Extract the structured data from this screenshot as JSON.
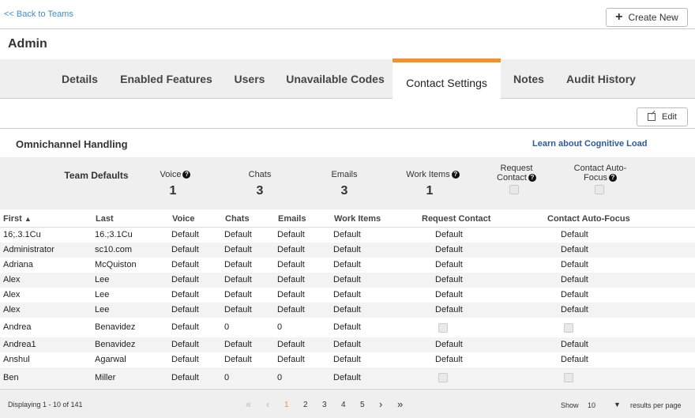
{
  "header": {
    "back_link": "<< Back to Teams",
    "create_button": "Create New",
    "page_title": "Admin"
  },
  "tabs": [
    {
      "label": "Details"
    },
    {
      "label": "Enabled Features"
    },
    {
      "label": "Users"
    },
    {
      "label": "Unavailable Codes"
    },
    {
      "label": "Contact Settings",
      "active": true
    },
    {
      "label": "Notes"
    },
    {
      "label": "Audit History"
    }
  ],
  "toolbar": {
    "edit_button": "Edit"
  },
  "section": {
    "title": "Omnichannel Handling",
    "learn_link": "Learn about Cognitive Load"
  },
  "team_defaults": {
    "label": "Team Defaults",
    "voice_label": "Voice",
    "voice_value": "1",
    "chats_label": "Chats",
    "chats_value": "3",
    "emails_label": "Emails",
    "emails_value": "3",
    "work_items_label": "Work Items",
    "work_items_value": "1",
    "request_contact_label_1": "Request",
    "request_contact_label_2": "Contact",
    "auto_focus_label_1": "Contact Auto-",
    "auto_focus_label_2": "Focus"
  },
  "table": {
    "columns": [
      "First",
      "Last",
      "Voice",
      "Chats",
      "Emails",
      "Work Items",
      "Request Contact",
      "Contact Auto-Focus"
    ],
    "sort_indicator": "▲",
    "rows": [
      {
        "first": "16;.3.1Cu",
        "last": "16.;3.1Cu",
        "voice": "Default",
        "chats": "Default",
        "emails": "Default",
        "work": "Default",
        "request": "Default",
        "focus": "Default"
      },
      {
        "first": "Administrator",
        "last": "sc10.com",
        "voice": "Default",
        "chats": "Default",
        "emails": "Default",
        "work": "Default",
        "request": "Default",
        "focus": "Default"
      },
      {
        "first": "Adriana",
        "last": "McQuiston",
        "voice": "Default",
        "chats": "Default",
        "emails": "Default",
        "work": "Default",
        "request": "Default",
        "focus": "Default"
      },
      {
        "first": "Alex",
        "last": "Lee",
        "voice": "Default",
        "chats": "Default",
        "emails": "Default",
        "work": "Default",
        "request": "Default",
        "focus": "Default"
      },
      {
        "first": "Alex",
        "last": "Lee",
        "voice": "Default",
        "chats": "Default",
        "emails": "Default",
        "work": "Default",
        "request": "Default",
        "focus": "Default"
      },
      {
        "first": "Alex",
        "last": "Lee",
        "voice": "Default",
        "chats": "Default",
        "emails": "Default",
        "work": "Default",
        "request": "Default",
        "focus": "Default"
      },
      {
        "first": "Andrea",
        "last": "Benavidez",
        "voice": "Default",
        "chats": "0",
        "emails": "0",
        "work": "Default",
        "request": "",
        "focus": ""
      },
      {
        "first": "Andrea1",
        "last": "Benavidez",
        "voice": "Default",
        "chats": "Default",
        "emails": "Default",
        "work": "Default",
        "request": "Default",
        "focus": "Default"
      },
      {
        "first": "Anshul",
        "last": "Agarwal",
        "voice": "Default",
        "chats": "Default",
        "emails": "Default",
        "work": "Default",
        "request": "Default",
        "focus": "Default"
      },
      {
        "first": "Ben",
        "last": "Miller",
        "voice": "Default",
        "chats": "0",
        "emails": "0",
        "work": "Default",
        "request": "",
        "focus": ""
      }
    ]
  },
  "footer": {
    "displaying": "Displaying 1 - 10 of 141",
    "pages": [
      "1",
      "2",
      "3",
      "4",
      "5"
    ],
    "current_page": "1",
    "show_label": "Show",
    "per_page_value": "10",
    "per_page_suffix": "results per page"
  }
}
